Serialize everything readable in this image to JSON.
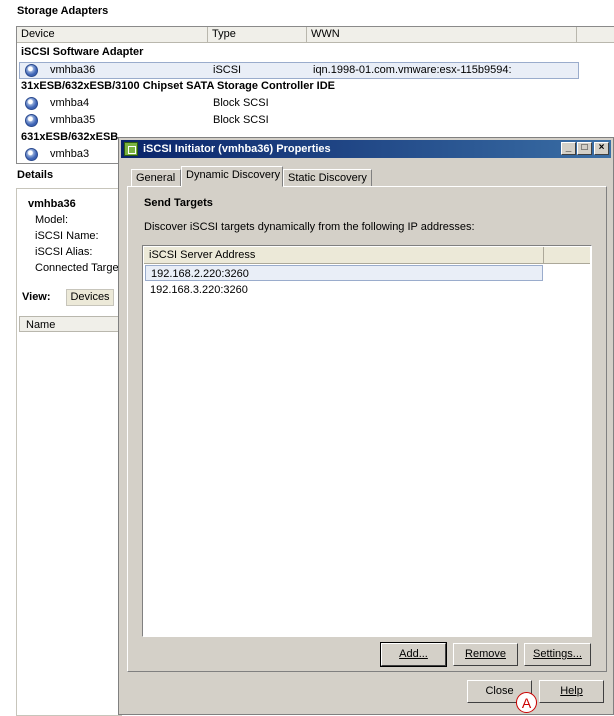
{
  "storage": {
    "title": "Storage Adapters",
    "columns": [
      "Device",
      "Type",
      "WWN"
    ],
    "rows": [
      {
        "kind": "group",
        "device": "iSCSI Software Adapter"
      },
      {
        "kind": "item",
        "device": "vmhba36",
        "type": "iSCSI",
        "wwn": "iqn.1998-01.com.vmware:esx-115b9594:",
        "selected": true
      },
      {
        "kind": "group",
        "device": "31xESB/632xESB/3100 Chipset SATA Storage Controller IDE"
      },
      {
        "kind": "item",
        "device": "vmhba4",
        "type": "Block SCSI"
      },
      {
        "kind": "item",
        "device": "vmhba35",
        "type": "Block SCSI"
      },
      {
        "kind": "group",
        "device": "631xESB/632xESB"
      },
      {
        "kind": "item",
        "device": "vmhba3"
      }
    ]
  },
  "details": {
    "title": "Details",
    "adapter_name": "vmhba36",
    "fields": [
      "Model:",
      "iSCSI Name:",
      "iSCSI Alias:",
      "Connected Targe"
    ],
    "view_label": "View:",
    "view_value": "Devices",
    "name_column": "Name"
  },
  "dialog": {
    "title": "iSCSI Initiator (vmhba36) Properties",
    "tabs": [
      "General",
      "Dynamic Discovery",
      "Static Discovery"
    ],
    "active_tab": "Dynamic Discovery",
    "section_title": "Send Targets",
    "description": "Discover iSCSI targets dynamically from the following IP addresses:",
    "list_column": "iSCSI Server Address",
    "addresses": [
      "192.168.2.220:3260",
      "192.168.3.220:3260"
    ],
    "buttons": {
      "add": "Add...",
      "remove": "Remove",
      "settings": "Settings...",
      "close": "Close",
      "help": "Help"
    }
  },
  "callout": {
    "label": "A"
  },
  "colors": {
    "titlebar_start": "#0a246a",
    "titlebar_end": "#3a6ea5",
    "selection": "#e9eef7",
    "callout": "#cc0000"
  }
}
